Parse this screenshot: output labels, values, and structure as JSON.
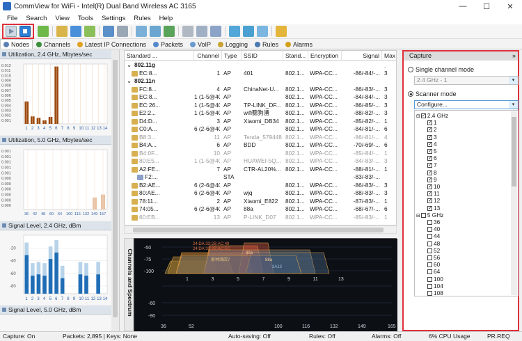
{
  "window": {
    "title": "CommView for WiFi - Intel(R) Dual Band Wireless AC 3165",
    "minimize": "—",
    "maximize": "☐",
    "close": "✕"
  },
  "menu": [
    "File",
    "Search",
    "View",
    "Tools",
    "Settings",
    "Rules",
    "Help"
  ],
  "tabs": [
    "Nodes",
    "Channels",
    "Latest IP Connections",
    "Packets",
    "VoIP",
    "Logging",
    "Rules",
    "Alarms"
  ],
  "left_charts": {
    "util24": {
      "title": "Utilization, 2.4 GHz, Mbytes/sec",
      "yticks": [
        "0.012",
        "0.011",
        "0.010",
        "0.009",
        "0.008",
        "0.007",
        "0.006",
        "0.005",
        "0.004",
        "0.003",
        "0.002",
        "0.001"
      ],
      "xticks": [
        "1",
        "2",
        "3",
        "4",
        "5",
        "6",
        "7",
        "8",
        "9",
        "10",
        "11",
        "12",
        "13",
        "14"
      ]
    },
    "util5": {
      "title": "Utilization, 5.0 GHz, Mbytes/sec",
      "yticks": [
        "0.001",
        "0.001",
        "0.001",
        "0.001",
        "0.001",
        "0.000",
        "0.000",
        "0.000",
        "0.000",
        "0.000",
        "0.000"
      ],
      "xticks": [
        "36",
        "42",
        "48",
        "60",
        "64",
        "100",
        "116",
        "132",
        "149",
        "157"
      ]
    },
    "sig24": {
      "title": "Signal Level, 2.4 GHz, dBm",
      "yticks": [
        "-20",
        "-40",
        "-60",
        "-80"
      ],
      "xticks": [
        "1",
        "2",
        "3",
        "4",
        "5",
        "6",
        "7",
        "8",
        "9",
        "10",
        "11",
        "12",
        "13",
        "14"
      ]
    },
    "sig5": {
      "title": "Signal Level, 5.0 GHz, dBm"
    }
  },
  "table": {
    "headers": [
      "Standard ...",
      "Channel",
      "Type",
      "SSID",
      "Stand...",
      "Encryption",
      "Signal",
      "Max ."
    ],
    "groups": [
      "802.11g",
      "802.11n"
    ],
    "rows": [
      {
        "mac": "EC:8...",
        "ch": "1",
        "type": "AP",
        "ssid": "401",
        "std": "802.1...",
        "enc": "WPA-CC...",
        "sig": "-86/-84/-...",
        "max": "3"
      },
      {
        "mac": "FC:8...",
        "ch": "4",
        "type": "AP",
        "ssid": "ChinaNet-U...",
        "std": "802.1...",
        "enc": "WPA-CC...",
        "sig": "-86/-83/-...",
        "max": "3"
      },
      {
        "mac": "EC:8...",
        "ch": "1 (1-5@40)",
        "type": "AP",
        "ssid": "",
        "std": "802.1...",
        "enc": "WPA-CC...",
        "sig": "-84/-84/-...",
        "max": "3"
      },
      {
        "mac": "EC:26...",
        "ch": "1 (1-5@40)",
        "type": "AP",
        "ssid": "TP-LINK_DF...",
        "std": "802.1...",
        "enc": "WPA-CC...",
        "sig": "-86/-85/-...",
        "max": "3"
      },
      {
        "mac": "E2:2...",
        "ch": "1 (1-5@40)",
        "type": "AP",
        "ssid": "wifi聽狗湧",
        "std": "802.1...",
        "enc": "WPA-CC...",
        "sig": "-88/-82/-...",
        "max": "3"
      },
      {
        "mac": "D4:D...",
        "ch": "3",
        "type": "AP",
        "ssid": "Xiaomi_DB34",
        "std": "802.1...",
        "enc": "WPA-CC...",
        "sig": "-85/-82/-...",
        "max": "1"
      },
      {
        "mac": "C0:A...",
        "ch": "6 (2-6@40)",
        "type": "AP",
        "ssid": "",
        "std": "802.1...",
        "enc": "WPA-CC...",
        "sig": "-84/-81/-...",
        "max": "6"
      },
      {
        "mac": "B8:3...",
        "ch": "11",
        "type": "AP",
        "ssid": "Tenda_579448",
        "std": "802.1...",
        "enc": "WPA-CC...",
        "sig": "-86/-81/-...",
        "max": "4",
        "dim": true
      },
      {
        "mac": "B4:A...",
        "ch": "6",
        "type": "AP",
        "ssid": "BDD",
        "std": "802.1...",
        "enc": "WPA-CC...",
        "sig": "-70/-69/-...",
        "max": "6"
      },
      {
        "mac": "B4:0F...",
        "ch": "10",
        "type": "AP",
        "ssid": "",
        "std": "802.1...",
        "enc": "WPA-CC...",
        "sig": "-85/-84/-...",
        "max": "1",
        "dim": true
      },
      {
        "mac": "80:E5...",
        "ch": "1 (1-5@40)",
        "type": "AP",
        "ssid": "HUAWEI-5Q...",
        "std": "802.1...",
        "enc": "WPA-CC...",
        "sig": "-84/-83/-...",
        "max": "3",
        "dim": true
      },
      {
        "mac": "A2:FE...",
        "ch": "7",
        "type": "AP",
        "ssid": "CTR-AL20%...",
        "std": "802.1...",
        "enc": "WPA-CC...",
        "sig": "-88/-81/-...",
        "max": "1"
      },
      {
        "mac": "F2:...",
        "ch": "",
        "type": "STA",
        "ssid": "",
        "std": "",
        "enc": "",
        "sig": "-83/-83/-...",
        "max": ""
      },
      {
        "mac": "B2:AE...",
        "ch": "6 (2-6@40)",
        "type": "AP",
        "ssid": "",
        "std": "802.1...",
        "enc": "WPA-CC...",
        "sig": "-86/-83/-...",
        "max": "3"
      },
      {
        "mac": "80:AE...",
        "ch": "6 (2-6@40)",
        "type": "AP",
        "ssid": "wjq",
        "std": "802.1...",
        "enc": "WPA-CC...",
        "sig": "-88/-83/-...",
        "max": "3"
      },
      {
        "mac": "78:11...",
        "ch": "2",
        "type": "AP",
        "ssid": "Xiaomi_E822",
        "std": "802.1...",
        "enc": "WPA-CC...",
        "sig": "-87/-83/-...",
        "max": "1"
      },
      {
        "mac": "74:05...",
        "ch": "6 (2-6@40)",
        "type": "AP",
        "ssid": "88a",
        "std": "802.1...",
        "enc": "WPA-CC...",
        "sig": "-68/-67/-...",
        "max": "6"
      },
      {
        "mac": "60:EB...",
        "ch": "13",
        "type": "AP",
        "ssid": "P-LINK_D07",
        "std": "802.1...",
        "enc": "WPA-CC...",
        "sig": "-85/-83/-...",
        "max": "1",
        "dim": true
      }
    ]
  },
  "spectrum": {
    "side_label": "Channels and Spectrum",
    "top_yticks": [
      "-50",
      "-75",
      "-100"
    ],
    "top_xticks": [
      "1",
      "3",
      "5",
      "7",
      "9",
      "11",
      "13"
    ],
    "bottom_yticks": [
      "-60",
      "-90"
    ],
    "bottom_xticks": [
      "36",
      "52",
      "100",
      "116",
      "132",
      "149",
      "165"
    ],
    "labels": [
      "24:DA:33:2B:AC:49",
      "24:DA:33:2B:AC:EC",
      "88a",
      "88a",
      "3A13",
      "家林酒店7"
    ]
  },
  "capture": {
    "title": "Capture",
    "single_label": "Single channel mode",
    "single_value": "2.4 GHz - 1",
    "scanner_label": "Scanner mode",
    "scanner_value": "Configure...",
    "band24": "2.4 GHz",
    "ch24": [
      "1",
      "2",
      "3",
      "4",
      "5",
      "6",
      "7",
      "8",
      "9",
      "10",
      "11",
      "12",
      "13"
    ],
    "band5": "5 GHz",
    "ch5": [
      "36",
      "40",
      "44",
      "48",
      "52",
      "56",
      "60",
      "64",
      "100",
      "104",
      "108",
      "112"
    ]
  },
  "status": {
    "capture": "Capture: On",
    "packets": "Packets: 2,895 | Keys: None",
    "autosave": "Auto-saving: Off",
    "rules": "Rules: Off",
    "alarms": "Alarms: Off",
    "cpu": "6% CPU Usage",
    "req": "PR.REQ"
  },
  "chart_data": [
    {
      "type": "bar",
      "title": "Utilization, 2.4 GHz, Mbytes/sec",
      "categories": [
        "1",
        "2",
        "3",
        "4",
        "5",
        "6",
        "7",
        "8",
        "9",
        "10",
        "11",
        "12",
        "13",
        "14"
      ],
      "values": [
        0.0045,
        0.0015,
        0.0012,
        0.0007,
        0.0014,
        0.0115,
        0,
        0,
        0,
        0,
        0,
        0,
        0,
        0
      ],
      "ylim": [
        0,
        0.012
      ]
    },
    {
      "type": "bar",
      "title": "Utilization, 5.0 GHz, Mbytes/sec",
      "categories": [
        "36",
        "42",
        "48",
        "60",
        "64",
        "100",
        "116",
        "132",
        "149",
        "157"
      ],
      "values": [
        0,
        0,
        0,
        0,
        0,
        0,
        0,
        0,
        0.0002,
        0.00025
      ],
      "ylim": [
        0,
        0.001
      ]
    },
    {
      "type": "bar",
      "title": "Signal Level, 2.4 GHz, dBm",
      "categories": [
        "1",
        "2",
        "3",
        "4",
        "5",
        "6",
        "7",
        "8",
        "9",
        "10",
        "11",
        "12",
        "13",
        "14"
      ],
      "values": [
        -70,
        -86,
        -85,
        -86,
        -73,
        -68,
        -88,
        0,
        0,
        -85,
        -86,
        0,
        -85,
        0
      ],
      "ylim": [
        -100,
        0
      ]
    }
  ]
}
